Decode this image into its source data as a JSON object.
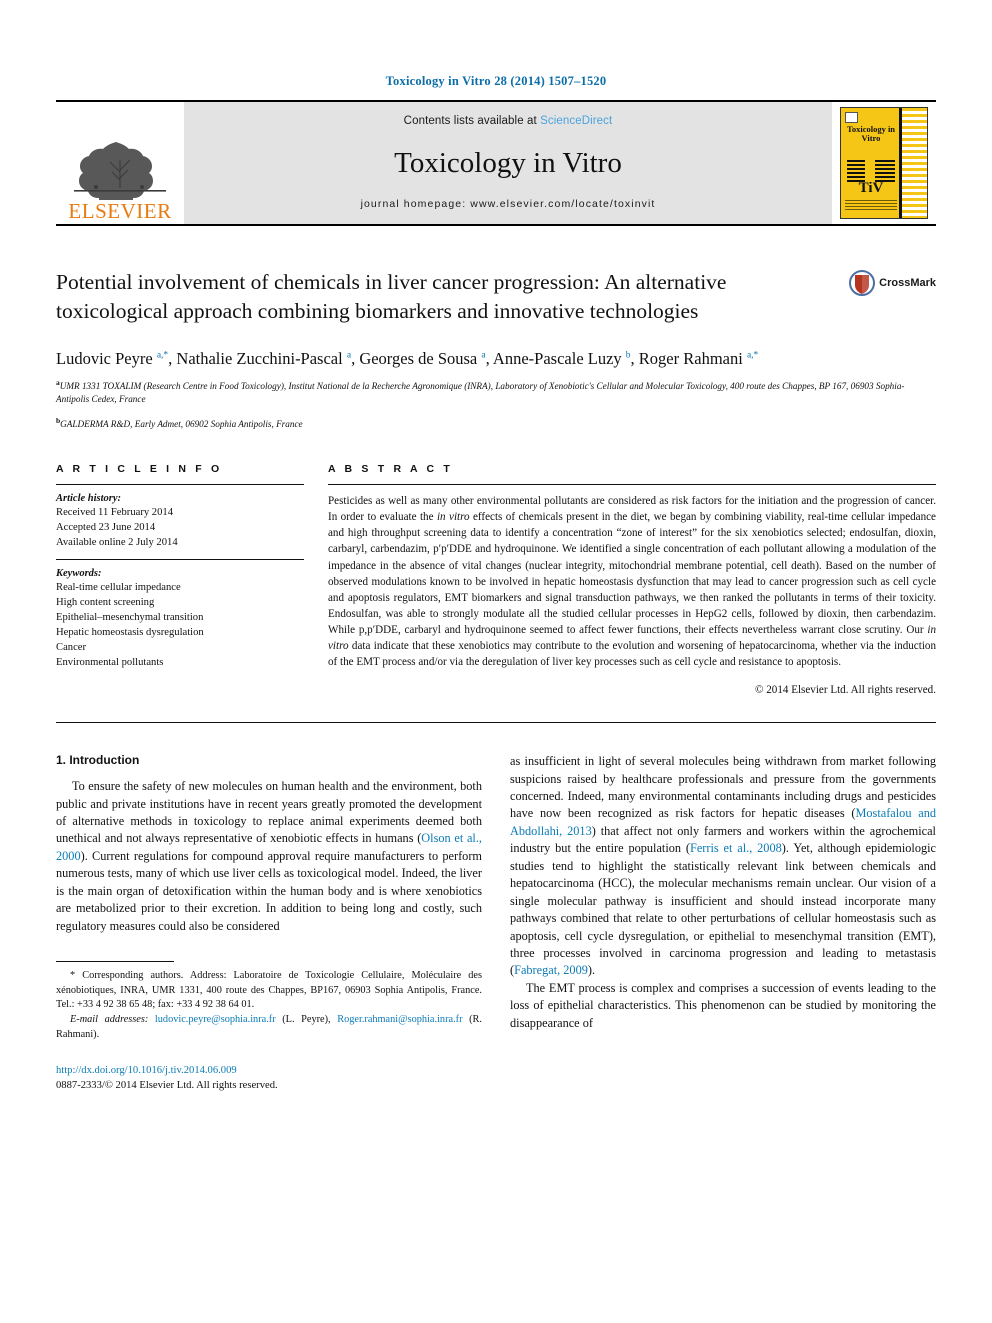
{
  "running_head": "Toxicology in Vitro 28 (2014) 1507–1520",
  "masthead": {
    "publisher_name": "ELSEVIER",
    "contents_prefix": "Contents lists available at ",
    "sciencedirect": "ScienceDirect",
    "journal_title": "Toxicology in Vitro",
    "homepage": "journal homepage: www.elsevier.com/locate/toxinvit",
    "cover_title": "Toxicology in Vitro",
    "cover_logo_text": "TiV"
  },
  "article": {
    "title": "Potential involvement of chemicals in liver cancer progression: An alternative toxicological approach combining biomarkers and innovative technologies",
    "crossmark_label": "CrossMark",
    "authors_html": "Ludovic Peyre <sup>a,*</sup>, Nathalie Zucchini-Pascal <sup>a</sup>, Georges de Sousa <sup>a</sup>, Anne-Pascale Luzy <sup>b</sup>, Roger Rahmani <sup>a,*</sup>",
    "affiliation_a": "UMR 1331 TOXALIM (Research Centre in Food Toxicology), Institut National de la Recherche Agronomique (INRA), Laboratory of Xenobiotic's Cellular and Molecular Toxicology, 400 route des Chappes, BP 167, 06903 Sophia-Antipolis Cedex, France",
    "affiliation_b": "GALDERMA R&D, Early Admet, 06902 Sophia Antipolis, France"
  },
  "article_info": {
    "heading": "A R T I C L E   I N F O",
    "history_label": "Article history:",
    "history": [
      "Received 11 February 2014",
      "Accepted 23 June 2014",
      "Available online 2 July 2014"
    ],
    "keywords_label": "Keywords:",
    "keywords": [
      "Real-time cellular impedance",
      "High content screening",
      "Epithelial–mesenchymal transition",
      "Hepatic homeostasis dysregulation",
      "Cancer",
      "Environmental pollutants"
    ]
  },
  "abstract": {
    "heading": "A B S T R A C T",
    "text_html": "Pesticides as well as many other environmental pollutants are considered as risk factors for the initiation and the progression of cancer. In order to evaluate the <i>in vitro</i> effects of chemicals present in the diet, we began by combining viability, real-time cellular impedance and high throughput screening data to identify a concentration “zone of interest” for the six xenobiotics selected; endosulfan, dioxin, carbaryl, carbendazim, p′p′DDE and hydroquinone. We identified a single concentration of each pollutant allowing a modulation of the impedance in the absence of vital changes (nuclear integrity, mitochondrial membrane potential, cell death). Based on the number of observed modulations known to be involved in hepatic homeostasis dysfunction that may lead to cancer progression such as cell cycle and apoptosis regulators, EMT biomarkers and signal transduction pathways, we then ranked the pollutants in terms of their toxicity. Endosulfan, was able to strongly modulate all the studied cellular processes in HepG2 cells, followed by dioxin, then carbendazim. While p,p′DDE, carbaryl and hydroquinone seemed to affect fewer functions, their effects nevertheless warrant close scrutiny. Our <i>in vitro</i> data indicate that these xenobiotics may contribute to the evolution and worsening of hepatocarcinoma, whether via the induction of the EMT process and/or via the deregulation of liver key processes such as cell cycle and resistance to apoptosis.",
    "copyright": "© 2014 Elsevier Ltd. All rights reserved."
  },
  "introduction": {
    "heading": "1. Introduction",
    "left_para_html": "To ensure the safety of new molecules on human health and the environment, both public and private institutions have in recent years greatly promoted the development of alternative methods in toxicology to replace animal experiments deemed both unethical and not always representative of xenobiotic effects in humans (<span class=\"cite\">Olson et al., 2000</span>). Current regulations for compound approval require manufacturers to perform numerous tests, many of which use liver cells as toxicological model. Indeed, the liver is the main organ of detoxification within the human body and is where xenobiotics are metabolized prior to their excretion. In addition to being long and costly, such regulatory measures could also be considered",
    "right_para1_html": "as insufficient in light of several molecules being withdrawn from market following suspicions raised by healthcare professionals and pressure from the governments concerned. Indeed, many environmental contaminants including drugs and pesticides have now been recognized as risk factors for hepatic diseases (<span class=\"cite\">Mostafalou and Abdollahi, 2013</span>) that affect not only farmers and workers within the agrochemical industry but the entire population (<span class=\"cite\">Ferris et al., 2008</span>). Yet, although epidemiologic studies tend to highlight the statistically relevant link between chemicals and hepatocarcinoma (HCC), the molecular mechanisms remain unclear. Our vision of a single molecular pathway is insufficient and should instead incorporate many pathways combined that relate to other perturbations of cellular homeostasis such as apoptosis, cell cycle dysregulation, or epithelial to mesenchymal transition (EMT), three processes involved in carcinoma progression and leading to metastasis (<span class=\"cite\">Fabregat, 2009</span>).",
    "right_para2_html": "The EMT process is complex and comprises a succession of events leading to the loss of epithelial characteristics. This phenomenon can be studied by monitoring the disappearance of"
  },
  "footnotes": {
    "corresponding_html": "* Corresponding authors. Address: Laboratoire de Toxicologie Cellulaire, Moléculaire des xénobiotiques, INRA, UMR 1331, 400 route des Chappes, BP167, 06903 Sophia Antipolis, France. Tel.: +33 4 92 38 65 48; fax: +33 4 92 38 64 01.",
    "email_html": "<i>E-mail addresses:</i> <span class=\"lnk\">ludovic.peyre@sophia.inra.fr</span> (L. Peyre), <span class=\"lnk\">Roger.rahmani@sophia.inra.fr</span> (R. Rahmani)."
  },
  "footer": {
    "doi": "http://dx.doi.org/10.1016/j.tiv.2014.06.009",
    "issn_line": "0887-2333/© 2014 Elsevier Ltd. All rights reserved."
  },
  "colors": {
    "link_blue": "#0b7bb5",
    "running_head_blue": "#0b6ea8",
    "elsevier_orange": "#e87b10",
    "sciencedirect_blue": "#4aa3df",
    "cover_yellow": "#f5c616",
    "masthead_gray": "#e3e3e3"
  }
}
